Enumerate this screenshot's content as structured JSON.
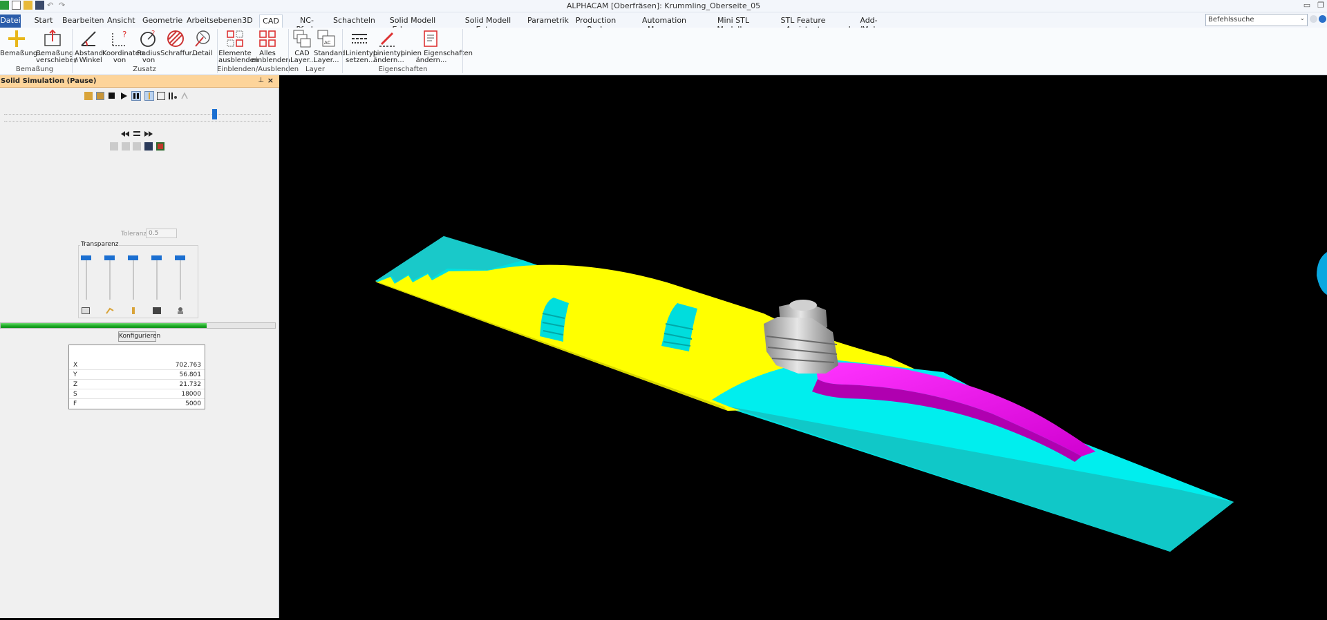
{
  "window": {
    "title": "ALPHACAM [Oberfräsen]: Krummling_Oberseite_05",
    "search_placeholder": "Befehlssuche"
  },
  "menu": {
    "file": "Datei",
    "tabs": [
      "Start",
      "Bearbeiten",
      "Ansicht",
      "Geometrie",
      "Arbeitsebenen",
      "3D",
      "CAD",
      "NC-Pfade",
      "Schachteln",
      "Solid Modell Erkennung",
      "Solid Modell Extras",
      "Parametrik",
      "Production Pack",
      "Automation Manager",
      "Mini STL Modeller",
      "STL Feature Assistent",
      "Add-Ins/Makros"
    ],
    "active": "CAD"
  },
  "ribbon": {
    "groups": {
      "bemassung": "Bemaßung",
      "zusatz": "Zusatz",
      "einblenden": "Einblenden/Ausblenden",
      "layer": "Layer",
      "eigenschaften": "Eigenschaften"
    },
    "buttons": {
      "bemassung": "Bemaßung...",
      "bemassung_verschieben": "Bemaßung\nverschieben",
      "abstand": "Abstand\n/ Winkel",
      "koordinaten": "Koordinaten\nvon",
      "radius": "Radius\nvon",
      "schraffur": "Schraffur...",
      "detail": "Detail",
      "elemente_ausblenden": "Elemente\nausblenden",
      "alles_einblenden": "Alles\neinblenden",
      "cad_layer": "CAD\nLayer...",
      "standard_layer": "Standard\nLayer...",
      "linientyp_setzen": "Linientyp\nsetzen...",
      "linientyp_aendern": "Linientyp\nändern...",
      "linien_eigenschaften": "Linien Eigenschaften\nändern..."
    }
  },
  "panel": {
    "title": "Solid Simulation (Pause)",
    "tolerance_label": "Toleranz",
    "tolerance_value": "0.5",
    "transparency_label": "Transparenz",
    "progress": 0.75,
    "configure_button": "Konfigurieren",
    "coords": [
      {
        "key": "X",
        "value": "702.763"
      },
      {
        "key": "Y",
        "value": "56.801"
      },
      {
        "key": "Z",
        "value": "21.732"
      },
      {
        "key": "S",
        "value": "18000"
      },
      {
        "key": "F",
        "value": "5000"
      }
    ]
  },
  "colors": {
    "part_top": "#ffff00",
    "stock": "#00e6e6",
    "toolpath_cut": "#ff00ff",
    "tool": "#c8c8c8",
    "viewport_bg": "#000000",
    "panel_header": "#fdd49a",
    "progress_green": "#1aa823"
  }
}
